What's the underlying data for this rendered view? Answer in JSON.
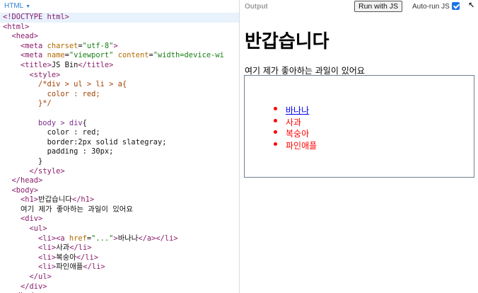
{
  "editor": {
    "panel_label": "HTML",
    "lines": [
      [
        {
          "c": "tag",
          "t": "<!DOCTYPE html>"
        }
      ],
      [
        {
          "c": "tag",
          "t": "<html>"
        }
      ],
      [
        {
          "c": "txt",
          "t": "  "
        },
        {
          "c": "tag",
          "t": "<head>"
        }
      ],
      [
        {
          "c": "txt",
          "t": "    "
        },
        {
          "c": "tag",
          "t": "<meta "
        },
        {
          "c": "attr",
          "t": "charset"
        },
        {
          "c": "txt",
          "t": "="
        },
        {
          "c": "str",
          "t": "\"utf-8\""
        },
        {
          "c": "tag",
          "t": ">"
        }
      ],
      [
        {
          "c": "txt",
          "t": "    "
        },
        {
          "c": "tag",
          "t": "<meta "
        },
        {
          "c": "attr",
          "t": "name"
        },
        {
          "c": "txt",
          "t": "="
        },
        {
          "c": "str",
          "t": "\"viewport\""
        },
        {
          "c": "txt",
          "t": " "
        },
        {
          "c": "attr",
          "t": "content"
        },
        {
          "c": "txt",
          "t": "="
        },
        {
          "c": "str",
          "t": "\"width=device-wi"
        }
      ],
      [
        {
          "c": "txt",
          "t": "    "
        },
        {
          "c": "tag",
          "t": "<title>"
        },
        {
          "c": "txt",
          "t": "JS Bin"
        },
        {
          "c": "tag",
          "t": "</title>"
        }
      ],
      [
        {
          "c": "txt",
          "t": "      "
        },
        {
          "c": "tag",
          "t": "<style>"
        }
      ],
      [
        {
          "c": "txt",
          "t": "        "
        },
        {
          "c": "com",
          "t": "/*div > ul > li > a{"
        }
      ],
      [
        {
          "c": "txt",
          "t": "          "
        },
        {
          "c": "com",
          "t": "color : red;"
        }
      ],
      [
        {
          "c": "txt",
          "t": "        "
        },
        {
          "c": "com",
          "t": "}*/"
        }
      ],
      [
        {
          "c": "txt",
          "t": ""
        }
      ],
      [
        {
          "c": "txt",
          "t": "        "
        },
        {
          "c": "sel",
          "t": "body > div"
        },
        {
          "c": "txt",
          "t": "{"
        }
      ],
      [
        {
          "c": "txt",
          "t": "          "
        },
        {
          "c": "prop",
          "t": "color"
        },
        {
          "c": "txt",
          "t": " : red;"
        }
      ],
      [
        {
          "c": "txt",
          "t": "          "
        },
        {
          "c": "prop",
          "t": "border"
        },
        {
          "c": "txt",
          "t": ":2px solid slategray;"
        }
      ],
      [
        {
          "c": "txt",
          "t": "          "
        },
        {
          "c": "prop",
          "t": "padding"
        },
        {
          "c": "txt",
          "t": " : 30px;"
        }
      ],
      [
        {
          "c": "txt",
          "t": "        }"
        }
      ],
      [
        {
          "c": "txt",
          "t": "      "
        },
        {
          "c": "tag",
          "t": "</style>"
        }
      ],
      [
        {
          "c": "txt",
          "t": "  "
        },
        {
          "c": "tag",
          "t": "</head>"
        }
      ],
      [
        {
          "c": "txt",
          "t": "  "
        },
        {
          "c": "tag",
          "t": "<body>"
        }
      ],
      [
        {
          "c": "txt",
          "t": "    "
        },
        {
          "c": "tag",
          "t": "<h1>"
        },
        {
          "c": "txt",
          "t": "반갑습니다"
        },
        {
          "c": "tag",
          "t": "</h1>"
        }
      ],
      [
        {
          "c": "txt",
          "t": "    여기 제가 좋아하는 과일이 있어요"
        }
      ],
      [
        {
          "c": "txt",
          "t": "    "
        },
        {
          "c": "tag",
          "t": "<div>"
        }
      ],
      [
        {
          "c": "txt",
          "t": "      "
        },
        {
          "c": "tag",
          "t": "<ul>"
        }
      ],
      [
        {
          "c": "txt",
          "t": "        "
        },
        {
          "c": "tag",
          "t": "<li><a "
        },
        {
          "c": "attr",
          "t": "href"
        },
        {
          "c": "txt",
          "t": "="
        },
        {
          "c": "str",
          "t": "\"...\""
        },
        {
          "c": "tag",
          "t": ">"
        },
        {
          "c": "txt",
          "t": "바나나"
        },
        {
          "c": "tag",
          "t": "</a></li>"
        }
      ],
      [
        {
          "c": "txt",
          "t": "        "
        },
        {
          "c": "tag",
          "t": "<li>"
        },
        {
          "c": "txt",
          "t": "사과"
        },
        {
          "c": "tag",
          "t": "</li>"
        }
      ],
      [
        {
          "c": "txt",
          "t": "        "
        },
        {
          "c": "tag",
          "t": "<li>"
        },
        {
          "c": "txt",
          "t": "복숭아"
        },
        {
          "c": "tag",
          "t": "</li>"
        }
      ],
      [
        {
          "c": "txt",
          "t": "        "
        },
        {
          "c": "tag",
          "t": "<li>"
        },
        {
          "c": "txt",
          "t": "파인애플"
        },
        {
          "c": "tag",
          "t": "</li>"
        }
      ],
      [
        {
          "c": "txt",
          "t": "      "
        },
        {
          "c": "tag",
          "t": "</ul>"
        }
      ],
      [
        {
          "c": "txt",
          "t": "    "
        },
        {
          "c": "tag",
          "t": "</div>"
        }
      ],
      [
        {
          "c": "txt",
          "t": "  "
        },
        {
          "c": "tag",
          "t": "</body>"
        }
      ]
    ]
  },
  "output": {
    "title": "Output",
    "run_button": "Run with JS",
    "autorun_label": "Auto-run JS",
    "autorun_checked": true,
    "popout_icon": "arrow-up-left-icon",
    "preview": {
      "heading": "반갑습니다",
      "description": "여기 제가 좋아하는 과일이 있어요",
      "fruits": [
        "바나나",
        "사과",
        "복숭아",
        "파인애플"
      ],
      "link_index": 0
    }
  },
  "colors": {
    "list_text": "#ff0000",
    "link": "#0000ee",
    "box_border": "#708090",
    "autorun_check": "#1a73e8",
    "editor_label": "#2f7fd6"
  }
}
